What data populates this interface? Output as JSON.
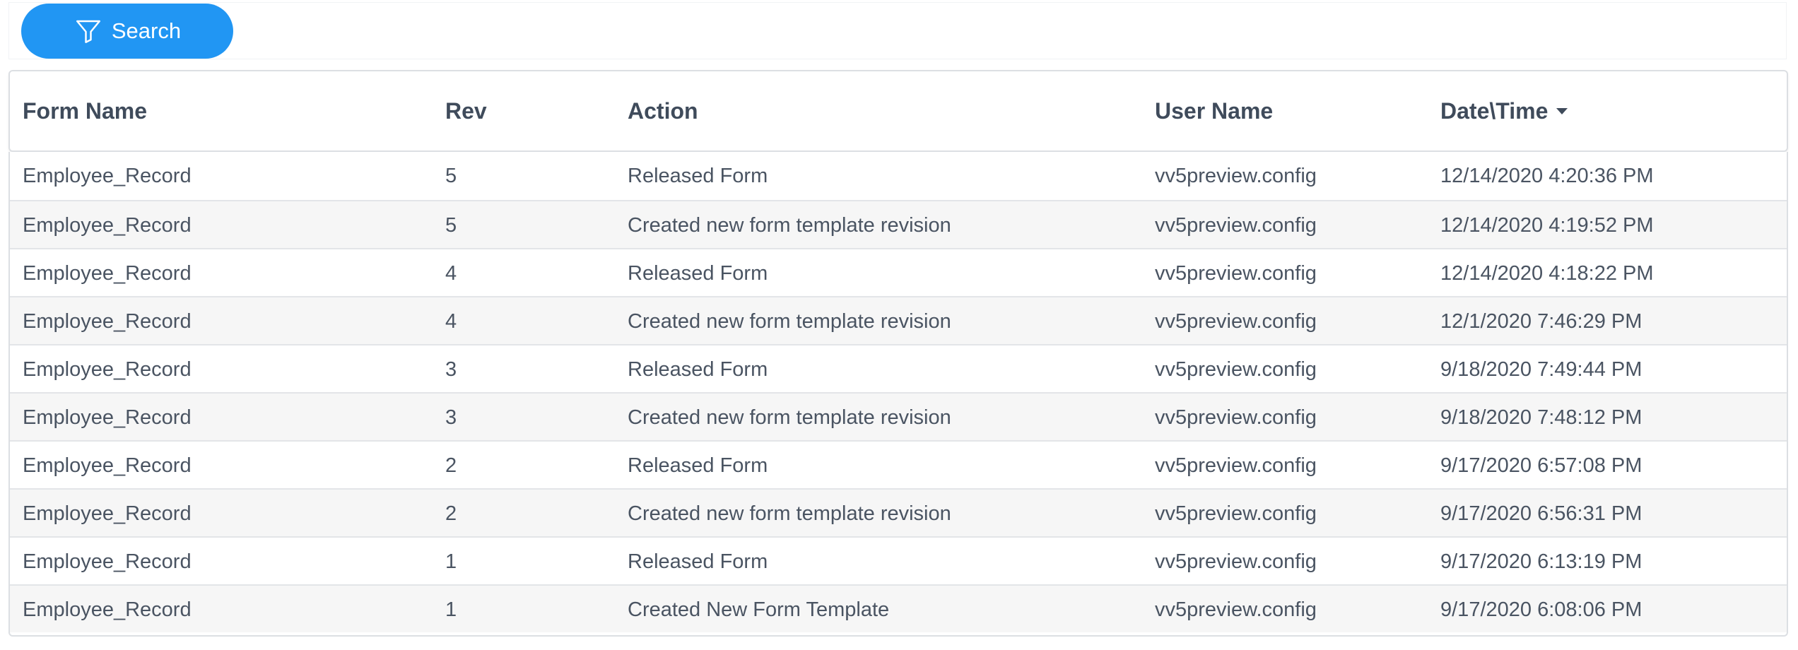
{
  "toolbar": {
    "search_label": "Search",
    "search_icon": "filter-icon",
    "accent_color": "#2196f3"
  },
  "table": {
    "columns": [
      {
        "key": "form_name",
        "label": "Form Name"
      },
      {
        "key": "rev",
        "label": "Rev"
      },
      {
        "key": "action",
        "label": "Action"
      },
      {
        "key": "user_name",
        "label": "User Name"
      },
      {
        "key": "date_time",
        "label": "Date\\Time",
        "sort": "descending"
      }
    ],
    "rows": [
      {
        "form_name": "Employee_Record",
        "rev": "5",
        "action": "Released Form",
        "user_name": "vv5preview.config",
        "date_time": "12/14/2020 4:20:36 PM"
      },
      {
        "form_name": "Employee_Record",
        "rev": "5",
        "action": "Created new form template revision",
        "user_name": "vv5preview.config",
        "date_time": "12/14/2020 4:19:52 PM"
      },
      {
        "form_name": "Employee_Record",
        "rev": "4",
        "action": "Released Form",
        "user_name": "vv5preview.config",
        "date_time": "12/14/2020 4:18:22 PM"
      },
      {
        "form_name": "Employee_Record",
        "rev": "4",
        "action": "Created new form template revision",
        "user_name": "vv5preview.config",
        "date_time": "12/1/2020 7:46:29 PM"
      },
      {
        "form_name": "Employee_Record",
        "rev": "3",
        "action": "Released Form",
        "user_name": "vv5preview.config",
        "date_time": "9/18/2020 7:49:44 PM"
      },
      {
        "form_name": "Employee_Record",
        "rev": "3",
        "action": "Created new form template revision",
        "user_name": "vv5preview.config",
        "date_time": "9/18/2020 7:48:12 PM"
      },
      {
        "form_name": "Employee_Record",
        "rev": "2",
        "action": "Released Form",
        "user_name": "vv5preview.config",
        "date_time": "9/17/2020 6:57:08 PM"
      },
      {
        "form_name": "Employee_Record",
        "rev": "2",
        "action": "Created new form template revision",
        "user_name": "vv5preview.config",
        "date_time": "9/17/2020 6:56:31 PM"
      },
      {
        "form_name": "Employee_Record",
        "rev": "1",
        "action": "Released Form",
        "user_name": "vv5preview.config",
        "date_time": "9/17/2020 6:13:19 PM"
      },
      {
        "form_name": "Employee_Record",
        "rev": "1",
        "action": "Created New Form Template",
        "user_name": "vv5preview.config",
        "date_time": "9/17/2020 6:08:06 PM"
      }
    ]
  }
}
